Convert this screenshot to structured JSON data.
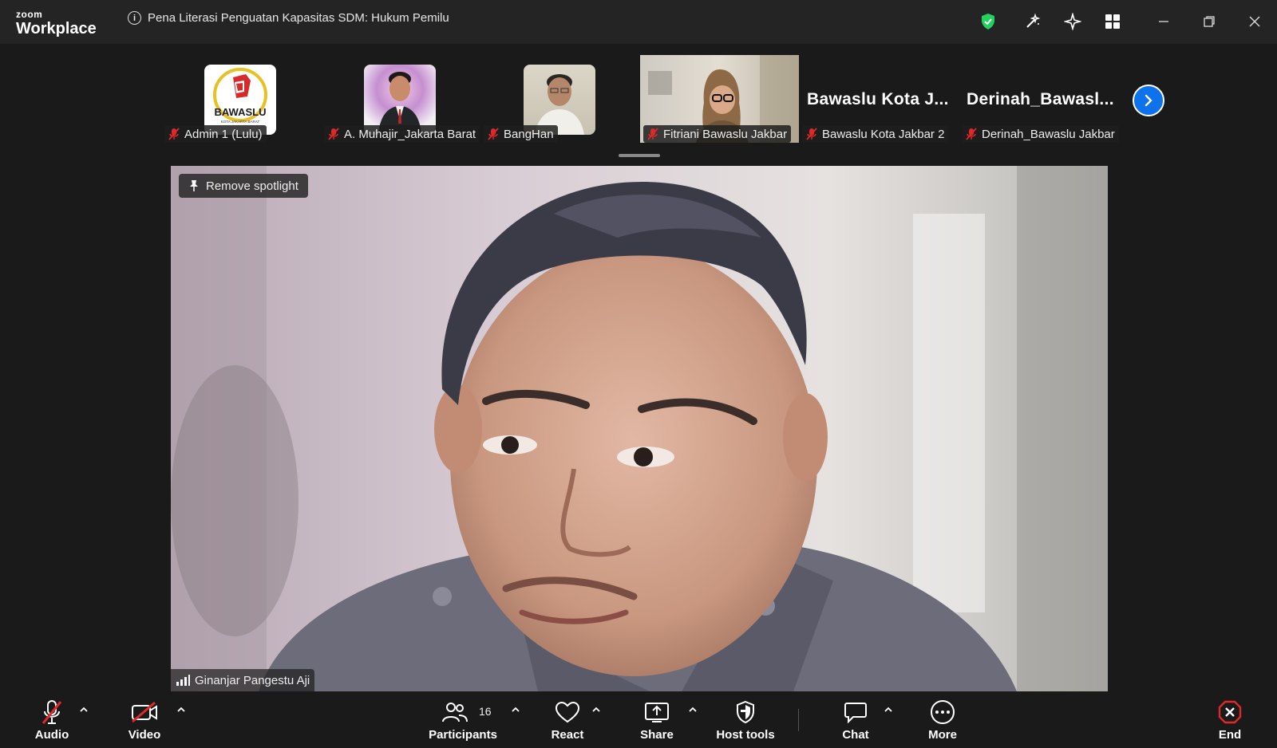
{
  "app": {
    "brand_top": "zoom",
    "brand_bottom": "Workplace",
    "meeting_title": "Pena Literasi Penguatan Kapasitas SDM: Hukum Pemilu"
  },
  "gallery": [
    {
      "name": "Admin 1 (Lulu)",
      "avatar": "bawaslu-logo"
    },
    {
      "name": "A. Muhajir_Jakarta Barat",
      "avatar": "photo"
    },
    {
      "name": "BangHan",
      "avatar": "photo"
    },
    {
      "name": "Fitriani Bawaslu Jakbar",
      "avatar": "video"
    },
    {
      "name": "Bawaslu Kota Jakbar 2",
      "display": "Bawaslu Kota J..."
    },
    {
      "name": "Derinah_Bawaslu Jakbar",
      "display": "Derinah_Bawasl..."
    }
  ],
  "logo_text": {
    "main": "BAWASLU",
    "sub": "KOTA JAKARTA BARAT"
  },
  "main_video": {
    "spotlight_label": "Remove spotlight",
    "speaker_name": "Ginanjar Pangestu Aji"
  },
  "toolbar": {
    "audio": "Audio",
    "video": "Video",
    "participants": "Participants",
    "participants_count": "16",
    "react": "React",
    "share": "Share",
    "host_tools": "Host tools",
    "chat": "Chat",
    "more": "More",
    "end": "End"
  },
  "colors": {
    "accent": "#0e72ed",
    "mute_red": "#e02828",
    "shield_green": "#23d160",
    "end_red": "#e02828"
  }
}
